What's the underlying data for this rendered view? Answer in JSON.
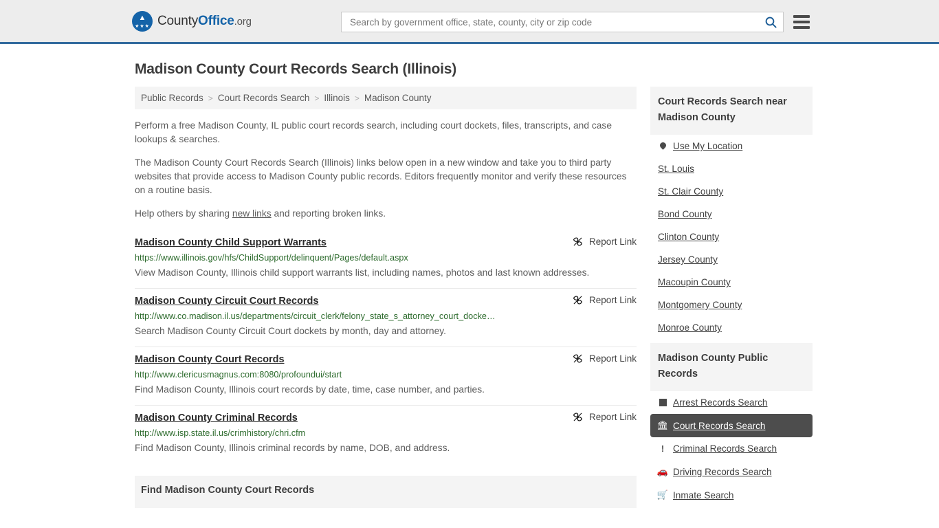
{
  "header": {
    "logo": {
      "part1": "County",
      "part2": "Office",
      "part3": ".org",
      "icon": "eagle-seal-icon"
    },
    "search": {
      "placeholder": "Search by government office, state, county, city or zip code",
      "value": "",
      "icon": "search-icon"
    },
    "menu_icon": "hamburger-menu-icon",
    "accent_color": "#336b9e"
  },
  "page": {
    "title": "Madison County Court Records Search (Illinois)"
  },
  "breadcrumb": {
    "items": [
      {
        "label": "Public Records"
      },
      {
        "label": "Court Records Search"
      },
      {
        "label": "Illinois"
      },
      {
        "label": "Madison County"
      }
    ],
    "separator": ">"
  },
  "intro": {
    "paragraph1": "Perform a free Madison County, IL public court records search, including court dockets, files, transcripts, and case lookups & searches.",
    "paragraph2": "The Madison County Court Records Search (Illinois) links below open in a new window and take you to third party websites that provide access to Madison County public records. Editors frequently monitor and verify these resources on a routine basis.",
    "paragraph3_before": "Help others by sharing ",
    "paragraph3_link": "new links",
    "paragraph3_after": " and reporting broken links."
  },
  "results": {
    "report_label": "Report Link",
    "report_icon": "broken-link-icon",
    "items": [
      {
        "title": "Madison County Child Support Warrants",
        "url": "https://www.illinois.gov/hfs/ChildSupport/delinquent/Pages/default.aspx",
        "description": "View Madison County, Illinois child support warrants list, including names, photos and last known addresses."
      },
      {
        "title": "Madison County Circuit Court Records",
        "url": "http://www.co.madison.il.us/departments/circuit_clerk/felony_state_s_attorney_court_docke…",
        "description": "Search Madison County Circuit Court dockets by month, day and attorney."
      },
      {
        "title": "Madison County Court Records",
        "url": "http://www.clericusmagnus.com:8080/profoundui/start",
        "description": "Find Madison County, Illinois court records by date, time, case number, and parties."
      },
      {
        "title": "Madison County Criminal Records",
        "url": "http://www.isp.state.il.us/crimhistory/chri.cfm",
        "description": "Find Madison County, Illinois criminal records by name, DOB, and address."
      }
    ]
  },
  "bottom_section": {
    "heading": "Find Madison County Court Records"
  },
  "sidebar": {
    "nearby": {
      "heading": "Court Records Search near Madison County",
      "items": [
        {
          "label": "Use My Location",
          "icon": "location-pin-icon"
        },
        {
          "label": "St. Louis",
          "icon": ""
        },
        {
          "label": "St. Clair County",
          "icon": ""
        },
        {
          "label": "Bond County",
          "icon": ""
        },
        {
          "label": "Clinton County",
          "icon": ""
        },
        {
          "label": "Jersey County",
          "icon": ""
        },
        {
          "label": "Macoupin County",
          "icon": ""
        },
        {
          "label": "Montgomery County",
          "icon": ""
        },
        {
          "label": "Monroe County",
          "icon": ""
        }
      ]
    },
    "public_records": {
      "heading": "Madison County Public Records",
      "items": [
        {
          "label": "Arrest Records Search",
          "icon": "square-icon",
          "active": false
        },
        {
          "label": "Court Records Search",
          "icon": "courthouse-icon",
          "active": true
        },
        {
          "label": "Criminal Records Search",
          "icon": "exclamation-icon",
          "active": false
        },
        {
          "label": "Driving Records Search",
          "icon": "car-icon",
          "active": false
        },
        {
          "label": "Inmate Search",
          "icon": "jail-icon",
          "active": false
        }
      ]
    }
  }
}
